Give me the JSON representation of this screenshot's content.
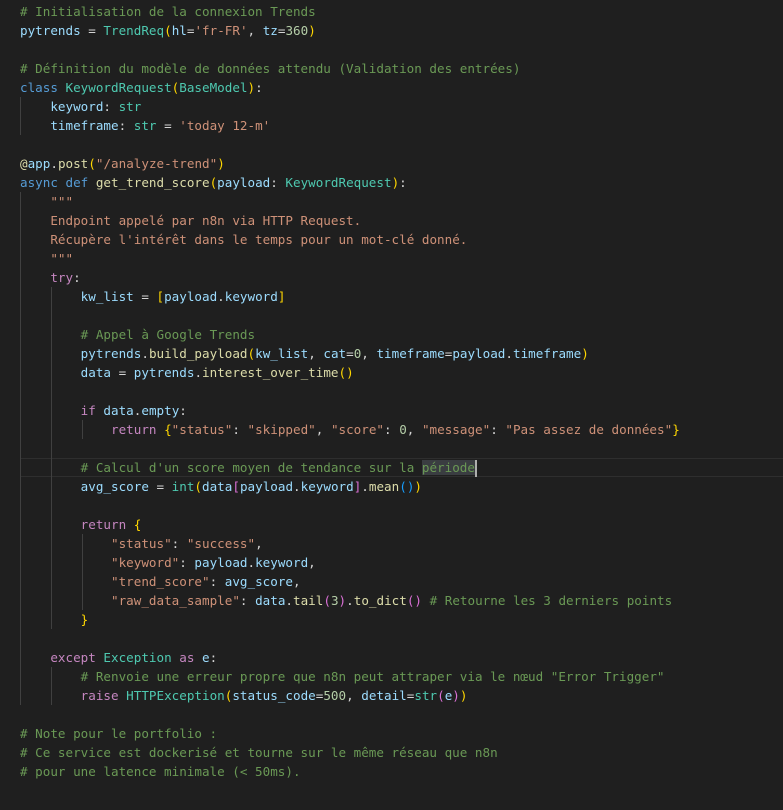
{
  "editor": {
    "language": "python",
    "current_line": 25,
    "colors": {
      "background": "#1f1f1f",
      "comment": "#6a9955",
      "keyword": "#569cd6",
      "control": "#c586c0",
      "variable": "#9cdcfe",
      "function": "#dcdcaa",
      "type": "#4ec9b0",
      "string": "#ce9178",
      "number": "#b5cea8"
    },
    "lines": [
      [
        [
          "c",
          "# Initialisation de la connexion Trends"
        ]
      ],
      [
        [
          "v",
          "pytrends"
        ],
        [
          "o",
          " = "
        ],
        [
          "t",
          "TrendReq"
        ],
        [
          "b1",
          "("
        ],
        [
          "v",
          "hl"
        ],
        [
          "o",
          "="
        ],
        [
          "s",
          "'fr-FR'"
        ],
        [
          "o",
          ", "
        ],
        [
          "v",
          "tz"
        ],
        [
          "o",
          "="
        ],
        [
          "n",
          "360"
        ],
        [
          "b1",
          ")"
        ]
      ],
      [],
      [
        [
          "c",
          "# Définition du modèle de données attendu (Validation des entrées)"
        ]
      ],
      [
        [
          "k",
          "class "
        ],
        [
          "t",
          "KeywordRequest"
        ],
        [
          "b1",
          "("
        ],
        [
          "t",
          "BaseModel"
        ],
        [
          "b1",
          ")"
        ],
        [
          "o",
          ":"
        ]
      ],
      [
        [
          "o",
          "    "
        ],
        [
          "v",
          "keyword"
        ],
        [
          "o",
          ": "
        ],
        [
          "t",
          "str"
        ]
      ],
      [
        [
          "o",
          "    "
        ],
        [
          "v",
          "timeframe"
        ],
        [
          "o",
          ": "
        ],
        [
          "t",
          "str"
        ],
        [
          "o",
          " = "
        ],
        [
          "s",
          "'today 12-m'"
        ]
      ],
      [],
      [
        [
          "f",
          "@"
        ],
        [
          "v",
          "app"
        ],
        [
          "o",
          "."
        ],
        [
          "f",
          "post"
        ],
        [
          "b1",
          "("
        ],
        [
          "s",
          "\"/analyze-trend\""
        ],
        [
          "b1",
          ")"
        ]
      ],
      [
        [
          "k",
          "async def "
        ],
        [
          "f",
          "get_trend_score"
        ],
        [
          "b1",
          "("
        ],
        [
          "v",
          "payload"
        ],
        [
          "o",
          ": "
        ],
        [
          "t",
          "KeywordRequest"
        ],
        [
          "b1",
          ")"
        ],
        [
          "o",
          ":"
        ]
      ],
      [
        [
          "o",
          "    "
        ],
        [
          "s",
          "\"\"\""
        ]
      ],
      [
        [
          "o",
          "    "
        ],
        [
          "s",
          "Endpoint appelé par n8n via HTTP Request."
        ]
      ],
      [
        [
          "o",
          "    "
        ],
        [
          "s",
          "Récupère l'intérêt dans le temps pour un mot-clé donné."
        ]
      ],
      [
        [
          "o",
          "    "
        ],
        [
          "s",
          "\"\"\""
        ]
      ],
      [
        [
          "o",
          "    "
        ],
        [
          "p",
          "try"
        ],
        [
          "o",
          ":"
        ]
      ],
      [
        [
          "o",
          "        "
        ],
        [
          "v",
          "kw_list"
        ],
        [
          "o",
          " = "
        ],
        [
          "b1",
          "["
        ],
        [
          "v",
          "payload"
        ],
        [
          "o",
          "."
        ],
        [
          "v",
          "keyword"
        ],
        [
          "b1",
          "]"
        ]
      ],
      [],
      [
        [
          "o",
          "        "
        ],
        [
          "c",
          "# Appel à Google Trends"
        ]
      ],
      [
        [
          "o",
          "        "
        ],
        [
          "v",
          "pytrends"
        ],
        [
          "o",
          "."
        ],
        [
          "f",
          "build_payload"
        ],
        [
          "b1",
          "("
        ],
        [
          "v",
          "kw_list"
        ],
        [
          "o",
          ", "
        ],
        [
          "v",
          "cat"
        ],
        [
          "o",
          "="
        ],
        [
          "n",
          "0"
        ],
        [
          "o",
          ", "
        ],
        [
          "v",
          "timeframe"
        ],
        [
          "o",
          "="
        ],
        [
          "v",
          "payload"
        ],
        [
          "o",
          "."
        ],
        [
          "v",
          "timeframe"
        ],
        [
          "b1",
          ")"
        ]
      ],
      [
        [
          "o",
          "        "
        ],
        [
          "v",
          "data"
        ],
        [
          "o",
          " = "
        ],
        [
          "v",
          "pytrends"
        ],
        [
          "o",
          "."
        ],
        [
          "f",
          "interest_over_time"
        ],
        [
          "b1",
          "()"
        ]
      ],
      [],
      [
        [
          "o",
          "        "
        ],
        [
          "p",
          "if "
        ],
        [
          "v",
          "data"
        ],
        [
          "o",
          "."
        ],
        [
          "v",
          "empty"
        ],
        [
          "o",
          ":"
        ]
      ],
      [
        [
          "o",
          "            "
        ],
        [
          "p",
          "return "
        ],
        [
          "b1",
          "{"
        ],
        [
          "s",
          "\"status\""
        ],
        [
          "o",
          ": "
        ],
        [
          "s",
          "\"skipped\""
        ],
        [
          "o",
          ", "
        ],
        [
          "s",
          "\"score\""
        ],
        [
          "o",
          ": "
        ],
        [
          "n",
          "0"
        ],
        [
          "o",
          ", "
        ],
        [
          "s",
          "\"message\""
        ],
        [
          "o",
          ": "
        ],
        [
          "s",
          "\"Pas assez de données\""
        ],
        [
          "b1",
          "}"
        ]
      ],
      [],
      [
        [
          "o",
          "        "
        ],
        [
          "c",
          "# Calcul d'un score moyen de tendance sur la "
        ],
        [
          "h",
          "période"
        ]
      ],
      [
        [
          "o",
          "        "
        ],
        [
          "v",
          "avg_score"
        ],
        [
          "o",
          " = "
        ],
        [
          "t",
          "int"
        ],
        [
          "b1",
          "("
        ],
        [
          "v",
          "data"
        ],
        [
          "b2",
          "["
        ],
        [
          "v",
          "payload"
        ],
        [
          "o",
          "."
        ],
        [
          "v",
          "keyword"
        ],
        [
          "b2",
          "]"
        ],
        [
          "o",
          "."
        ],
        [
          "f",
          "mean"
        ],
        [
          "b3",
          "()"
        ],
        [
          "b1",
          ")"
        ]
      ],
      [],
      [
        [
          "o",
          "        "
        ],
        [
          "p",
          "return "
        ],
        [
          "b1",
          "{"
        ]
      ],
      [
        [
          "o",
          "            "
        ],
        [
          "s",
          "\"status\""
        ],
        [
          "o",
          ": "
        ],
        [
          "s",
          "\"success\""
        ],
        [
          "o",
          ","
        ]
      ],
      [
        [
          "o",
          "            "
        ],
        [
          "s",
          "\"keyword\""
        ],
        [
          "o",
          ": "
        ],
        [
          "v",
          "payload"
        ],
        [
          "o",
          "."
        ],
        [
          "v",
          "keyword"
        ],
        [
          "o",
          ","
        ]
      ],
      [
        [
          "o",
          "            "
        ],
        [
          "s",
          "\"trend_score\""
        ],
        [
          "o",
          ": "
        ],
        [
          "v",
          "avg_score"
        ],
        [
          "o",
          ","
        ]
      ],
      [
        [
          "o",
          "            "
        ],
        [
          "s",
          "\"raw_data_sample\""
        ],
        [
          "o",
          ": "
        ],
        [
          "v",
          "data"
        ],
        [
          "o",
          "."
        ],
        [
          "f",
          "tail"
        ],
        [
          "b2",
          "("
        ],
        [
          "n",
          "3"
        ],
        [
          "b2",
          ")"
        ],
        [
          "o",
          "."
        ],
        [
          "f",
          "to_dict"
        ],
        [
          "b2",
          "()"
        ],
        [
          "o",
          " "
        ],
        [
          "c",
          "# Retourne les 3 derniers points"
        ]
      ],
      [
        [
          "o",
          "        "
        ],
        [
          "b1",
          "}"
        ]
      ],
      [],
      [
        [
          "o",
          "    "
        ],
        [
          "p",
          "except "
        ],
        [
          "t",
          "Exception"
        ],
        [
          "o",
          " "
        ],
        [
          "p",
          "as "
        ],
        [
          "v",
          "e"
        ],
        [
          "o",
          ":"
        ]
      ],
      [
        [
          "o",
          "        "
        ],
        [
          "c",
          "# Renvoie une erreur propre que n8n peut attraper via le nœud \"Error Trigger\""
        ]
      ],
      [
        [
          "o",
          "        "
        ],
        [
          "p",
          "raise "
        ],
        [
          "t",
          "HTTPException"
        ],
        [
          "b1",
          "("
        ],
        [
          "v",
          "status_code"
        ],
        [
          "o",
          "="
        ],
        [
          "n",
          "500"
        ],
        [
          "o",
          ", "
        ],
        [
          "v",
          "detail"
        ],
        [
          "o",
          "="
        ],
        [
          "t",
          "str"
        ],
        [
          "b2",
          "("
        ],
        [
          "v",
          "e"
        ],
        [
          "b2",
          ")"
        ],
        [
          "b1",
          ")"
        ]
      ],
      [],
      [
        [
          "c",
          "# Note pour le portfolio :"
        ]
      ],
      [
        [
          "c",
          "# Ce service est dockerisé et tourne sur le même réseau que n8n"
        ]
      ],
      [
        [
          "c",
          "# pour une latence minimale (< 50ms)."
        ]
      ]
    ]
  }
}
